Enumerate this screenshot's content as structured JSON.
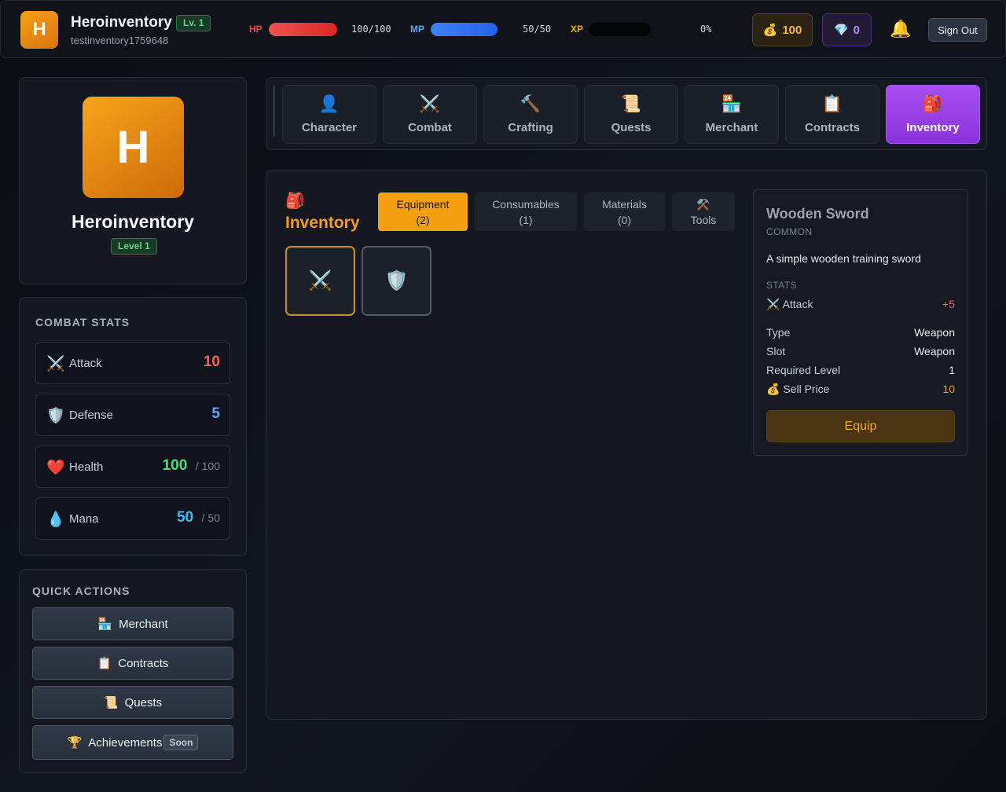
{
  "header": {
    "avatar_letter": "H",
    "name": "Heroinventory",
    "level_badge": "Lv. 1",
    "username": "testinventory1759648",
    "hp": {
      "label": "HP",
      "value": "100/100",
      "fraction": 1.0,
      "color": "#ef4444"
    },
    "mp": {
      "label": "MP",
      "value": "50/50",
      "fraction": 1.0,
      "color": "#3b82f6"
    },
    "xp": {
      "label": "XP",
      "value": "0%",
      "fraction": 0.0,
      "color": "#eab308"
    },
    "gold": {
      "icon": "money-bag-icon",
      "value": "100"
    },
    "gems": {
      "icon": "gem-icon",
      "value": "0"
    },
    "bell_icon": "bell-icon",
    "sign_out": "Sign Out"
  },
  "profile": {
    "avatar_letter": "H",
    "name": "Heroinventory",
    "level": "Level 1"
  },
  "combat_stats": {
    "title": "COMBAT STATS",
    "rows": [
      {
        "icon": "crossed-swords-icon",
        "name": "Attack",
        "value": "10",
        "max": "",
        "color": "#f06565"
      },
      {
        "icon": "shield-icon",
        "name": "Defense",
        "value": "5",
        "max": "",
        "color": "#60a5fa"
      },
      {
        "icon": "heart-icon",
        "name": "Health",
        "value": "100",
        "max": "/ 100",
        "color": "#4ade80"
      },
      {
        "icon": "droplet-icon",
        "name": "Mana",
        "value": "50",
        "max": "/ 50",
        "color": "#38bdf8"
      }
    ]
  },
  "quick_actions": {
    "title": "QUICK ACTIONS",
    "buttons": [
      {
        "icon": "merchant-icon",
        "label": "Merchant"
      },
      {
        "icon": "clipboard-icon",
        "label": "Contracts"
      },
      {
        "icon": "scroll-icon",
        "label": "Quests"
      },
      {
        "icon": "trophy-icon",
        "label": "Achievements",
        "badge": "Soon"
      }
    ]
  },
  "nav_tabs": [
    {
      "icon": "person-icon",
      "label": "Character"
    },
    {
      "icon": "crossed-swords-icon",
      "label": "Combat"
    },
    {
      "icon": "hammer-icon",
      "label": "Crafting"
    },
    {
      "icon": "scroll-icon",
      "label": "Quests"
    },
    {
      "icon": "merchant-icon",
      "label": "Merchant"
    },
    {
      "icon": "clipboard-icon",
      "label": "Contracts"
    },
    {
      "icon": "backpack-icon",
      "label": "Inventory",
      "active": true
    }
  ],
  "inventory": {
    "icon": "backpack-icon",
    "title": "Inventory",
    "sub_tabs": [
      {
        "label": "Equipment",
        "count": "(2)",
        "active": true
      },
      {
        "label": "Consumables",
        "count": "(1)"
      },
      {
        "label": "Materials",
        "count": "(0)"
      },
      {
        "icon": "hammer-pick-icon",
        "label": "Tools"
      }
    ],
    "items": [
      {
        "icon": "crossed-swords-icon",
        "selected": true
      },
      {
        "icon": "shield-icon"
      }
    ]
  },
  "detail": {
    "name": "Wooden Sword",
    "rarity": "COMMON",
    "description": "A simple wooden training sword",
    "stats_title": "STATS",
    "stat": {
      "icon": "crossed-swords-icon",
      "label": "Attack",
      "value": "+5",
      "color": "#f06565"
    },
    "rows": [
      {
        "label": "Type",
        "value": "Weapon"
      },
      {
        "label": "Slot",
        "value": "Weapon"
      },
      {
        "label": "Required Level",
        "value": "1"
      },
      {
        "icon": "money-bag-icon",
        "label": "Sell Price",
        "value": "10",
        "color": "#f39d1b"
      }
    ],
    "equip_label": "Equip"
  }
}
